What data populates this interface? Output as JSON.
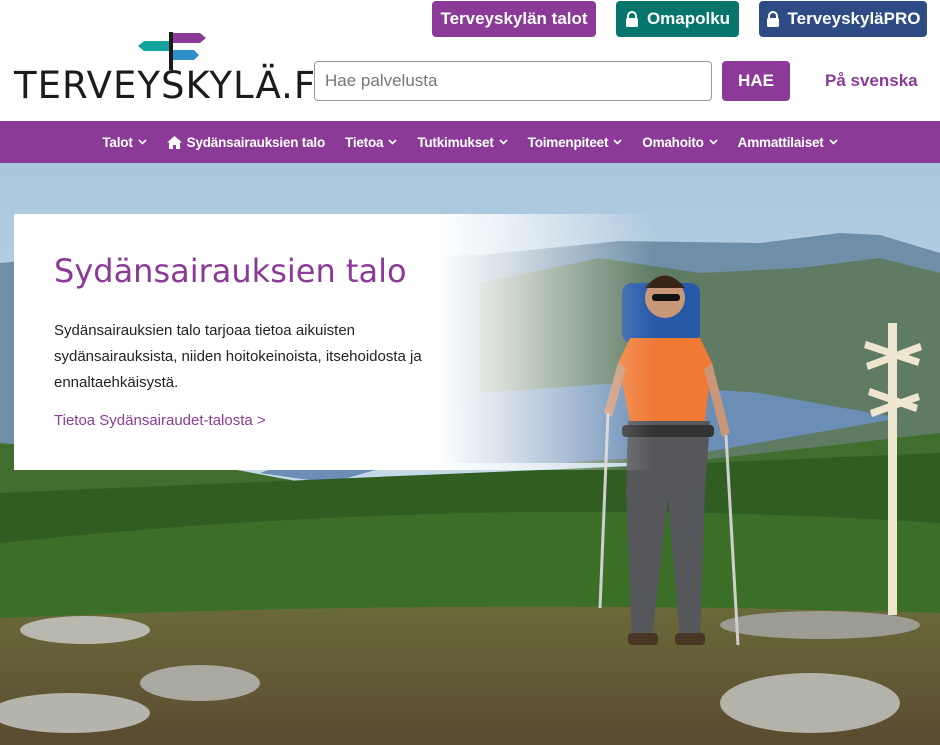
{
  "top_buttons": {
    "talot": "Terveyskylän talot",
    "omapolku": "Omapolku",
    "pro": "TerveyskyläPRO"
  },
  "logo": {
    "text": "TERVEYSKYLÄ.FI"
  },
  "search": {
    "placeholder": "Hae palvelusta",
    "value": "",
    "button": "HAE"
  },
  "lang_link": "På svenska",
  "nav": {
    "items": [
      {
        "label": "Talot",
        "icon": "chevron-down-icon"
      },
      {
        "label": "Sydänsairauksien talo",
        "icon": "home-icon"
      },
      {
        "label": "Tietoa",
        "icon": "chevron-down-icon"
      },
      {
        "label": "Tutkimukset",
        "icon": "chevron-down-icon"
      },
      {
        "label": "Toimenpiteet",
        "icon": "chevron-down-icon"
      },
      {
        "label": "Omahoito",
        "icon": "chevron-down-icon"
      },
      {
        "label": "Ammattilaiset",
        "icon": "chevron-down-icon"
      }
    ]
  },
  "hero": {
    "title": "Sydänsairauksien talo",
    "description": "Sydänsairauksien talo tarjoaa tietoa aikuisten sydänsairauksista, niiden hoitokeinoista, itsehoidosta ja ennaltaehkäisystä.",
    "link": "Tietoa Sydänsairaudet-talosta >"
  },
  "colors": {
    "brand_purple": "#8b3b97",
    "teal": "#06756b",
    "navy": "#2e4b86"
  }
}
